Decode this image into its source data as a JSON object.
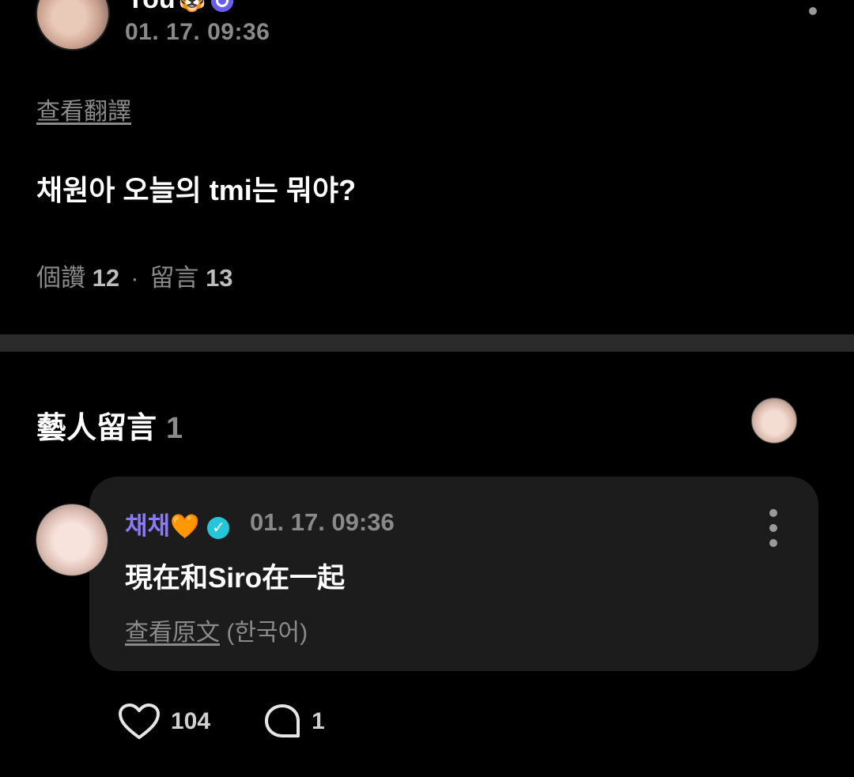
{
  "post": {
    "author_name": "You",
    "author_emoji": "🐯",
    "time": "01. 17. 09:36",
    "see_translation": "查看翻譯",
    "body": "채원아 오늘의 tmi는 뭐야?",
    "likes_label": "個讚",
    "likes_count": "12",
    "comments_label": "留言",
    "comments_count": "13",
    "dot_separator": "·"
  },
  "artist_comments": {
    "title": "藝人留言",
    "count": "1"
  },
  "comment": {
    "author": "채채",
    "heart": "🧡",
    "verified_mark": "✓",
    "time": "01. 17. 09:36",
    "text": "現在和Siro在一起",
    "see_original_link": "查看原文",
    "see_original_lang": "(한국어)",
    "like_count": "104",
    "reply_count": "1"
  },
  "colors": {
    "background": "#000000",
    "card": "#1c1c1c",
    "artist_name": "#8c78ff",
    "verified": "#26c6da",
    "muted": "#8a8a8a"
  }
}
